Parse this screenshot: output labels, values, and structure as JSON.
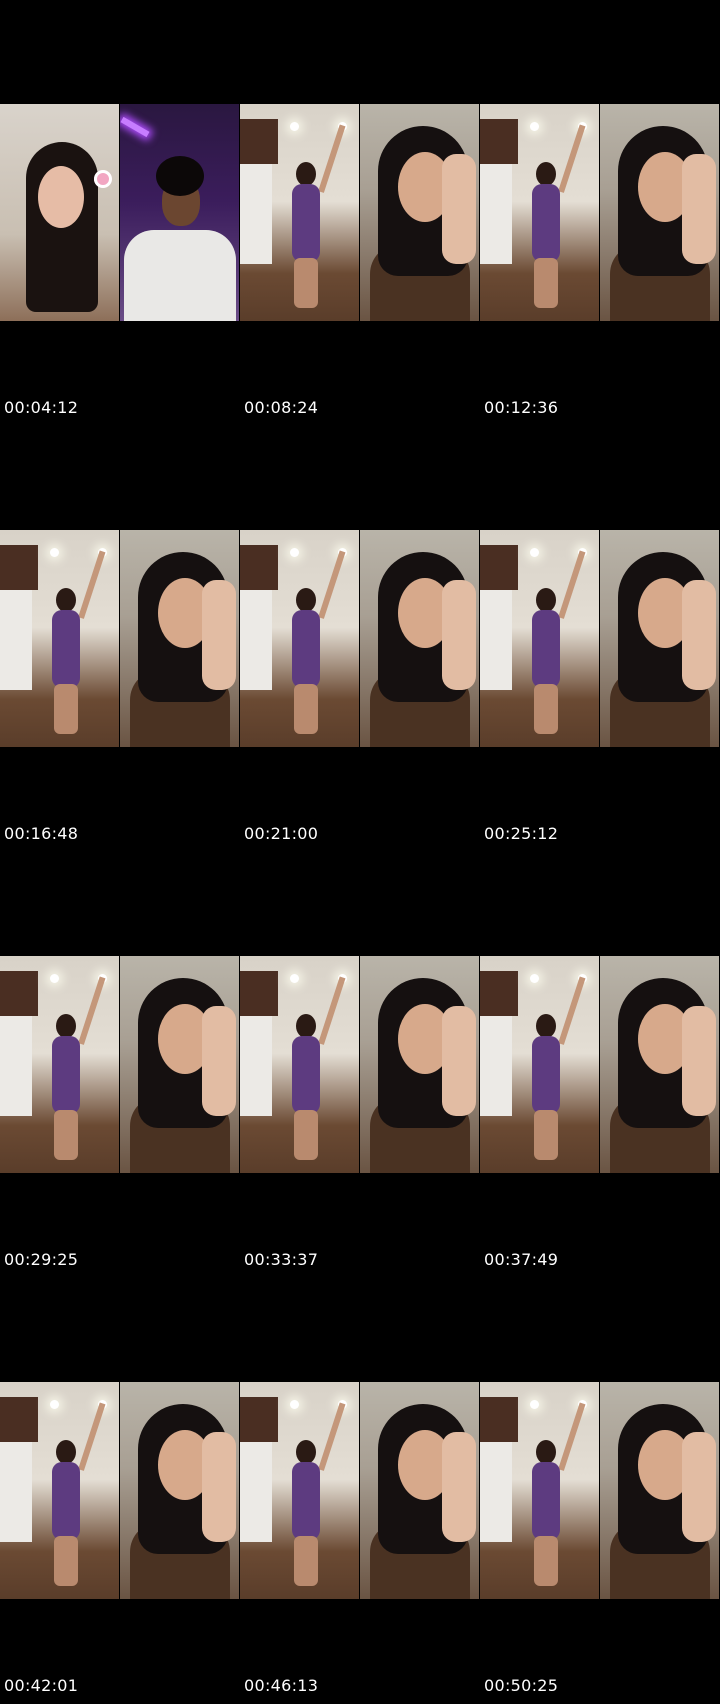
{
  "rows": [
    {
      "timestamps": [
        "00:04:12",
        "00:08:24",
        "00:12:36"
      ]
    },
    {
      "timestamps": [
        "00:16:48",
        "00:21:00",
        "00:25:12"
      ]
    },
    {
      "timestamps": [
        "00:29:25",
        "00:33:37",
        "00:37:49"
      ]
    },
    {
      "timestamps": [
        "00:42:01",
        "00:46:13",
        "00:50:25"
      ]
    }
  ],
  "thumbnail_scenes": {
    "row1": [
      "girl-with-flower",
      "man-purple-room",
      "kitchen-standing",
      "selfie-closeup",
      "kitchen-standing",
      "selfie-closeup"
    ],
    "row2": [
      "kitchen-standing",
      "selfie-closeup",
      "kitchen-standing",
      "selfie-closeup",
      "kitchen-standing",
      "selfie-closeup"
    ],
    "row3": [
      "kitchen-standing",
      "selfie-closeup",
      "kitchen-standing",
      "selfie-closeup",
      "kitchen-standing",
      "selfie-closeup"
    ],
    "row4": [
      "kitchen-standing",
      "selfie-closeup",
      "kitchen-standing",
      "selfie-closeup",
      "kitchen-standing",
      "selfie-closeup"
    ]
  }
}
